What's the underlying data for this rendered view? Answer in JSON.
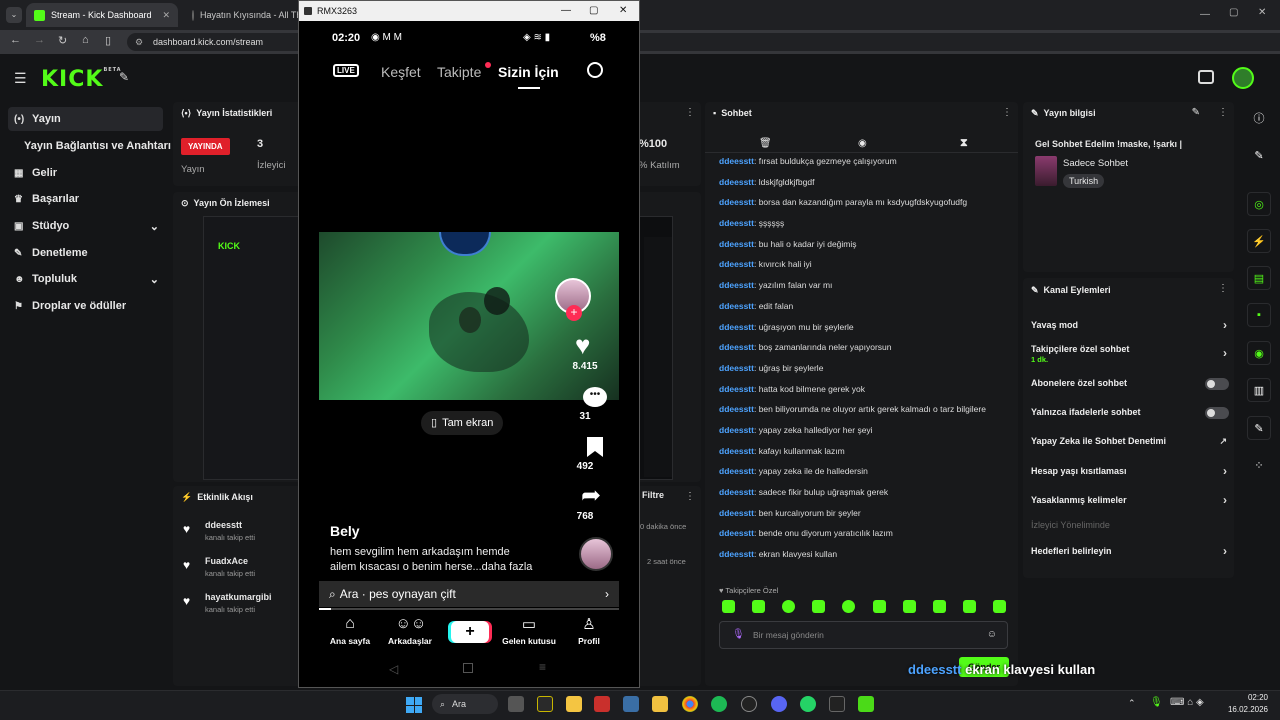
{
  "browser": {
    "tabs": [
      {
        "title": "Stream - Kick Dashboard"
      },
      {
        "title": "Hayatın Kıyısında - All The"
      }
    ],
    "url": "dashboard.kick.com/stream"
  },
  "kick": {
    "logo": "KICK",
    "logo_badge": "BETA"
  },
  "sidebar": {
    "items": [
      {
        "label": "Yayın",
        "icon": "broadcast-icon"
      },
      {
        "label": "Yayın Bağlantısı ve Anahtarı",
        "icon": ""
      },
      {
        "label": "Gelir",
        "icon": "revenue-icon"
      },
      {
        "label": "Başarılar",
        "icon": "trophy-icon"
      },
      {
        "label": "Stüdyo",
        "icon": "studio-icon"
      },
      {
        "label": "Denetleme",
        "icon": "wrench-icon"
      },
      {
        "label": "Topluluk",
        "icon": "community-icon"
      },
      {
        "label": "Droplar ve ödüller",
        "icon": "gift-icon"
      }
    ]
  },
  "stats": {
    "title": "Yayın İstatistikleri",
    "badge": "YAYINDA",
    "badge_sub": "Yayın",
    "viewers": "3",
    "viewers_label": "İzleyici",
    "percent": "%100",
    "percent_label": "% Katılım"
  },
  "preview": {
    "title": "Yayın Ön İzlemesi"
  },
  "activity": {
    "title": "Etkinlik Akışı",
    "filter": "Filtre",
    "items": [
      {
        "name": "ddeesstt",
        "action": "kanalı takip etti",
        "time": "0 dakika önce"
      },
      {
        "name": "FuadxAce",
        "action": "kanalı takip etti",
        "time": "2 saat önce"
      },
      {
        "name": "hayatkumargibi",
        "action": "kanalı takip etti",
        "time": ""
      }
    ]
  },
  "chat": {
    "title": "Sohbet",
    "user": "ddeesstt",
    "messages": [
      "fırsat buldukça gezmeye çalışıyorum",
      "ldskjfgldkjfbgdf",
      "borsa dan kazandığım parayla mı ksdyugfdskyugofudfg",
      "şşşşşş",
      "bu hali o kadar iyi değimiş",
      "kıvırcık hali iyi",
      "yazılım falan var mı",
      "edit falan",
      "uğraşıyon mu bir şeylerle",
      "boş zamanlarında neler yapıyorsun",
      "uğraş bir şeylerle",
      "hatta kod bilmene gerek yok",
      "ben biliyorumda ne oluyor artık gerek kalmadı o tarz bilgilere",
      "yapay zeka hallediyor her şeyi",
      "kafayı kullanmak lazım",
      "yapay zeka ile de halledersin",
      "sadece fikir bulup uğraşmak gerek",
      "ben kurcalıyorum bir şeyler",
      "bende onu diyorum yaratıcılık lazım",
      "ekran klavyesi kullan"
    ],
    "followers_only": "Takipçilere Özel",
    "input_placeholder": "Bir mesaj gönderin",
    "send": "Gönder",
    "overlay_user": "ddeesstt",
    "overlay_text": "ekran klavyesi kullan"
  },
  "streaminfo": {
    "title": "Yayın bilgisi",
    "stream_title": "Gel Sohbet Edelim !maske, !şarkı |",
    "category": "Sadece Sohbet",
    "tag": "Turkish"
  },
  "actions": {
    "title": "Kanal Eylemleri",
    "items": [
      {
        "label": "Yavaş mod",
        "sub": "",
        "control": "chevron"
      },
      {
        "label": "Takipçilere özel sohbet",
        "sub": "1 dk.",
        "control": "chevron"
      },
      {
        "label": "Abonelere özel sohbet",
        "sub": "",
        "control": "toggle"
      },
      {
        "label": "Yalnızca ifadelerle sohbet",
        "sub": "",
        "control": "toggle"
      },
      {
        "label": "Yapay Zeka ile Sohbet Denetimi",
        "sub": "",
        "control": "external"
      },
      {
        "label": "Hesap yaşı kısıtlaması",
        "sub": "",
        "control": "chevron"
      },
      {
        "label": "Yasaklanmış kelimeler",
        "sub": "",
        "control": "chevron"
      },
      {
        "label": "İzleyici Yöneliminde",
        "sub": "",
        "control": "none"
      },
      {
        "label": "Hedefleri belirleyin",
        "sub": "",
        "control": "chevron"
      }
    ]
  },
  "phone": {
    "window_title": "RMX3263",
    "time": "02:20",
    "battery": "%8",
    "tabs": {
      "live": "LIVE",
      "explore": "Keşfet",
      "following": "Takipte",
      "foryou": "Sizin İçin"
    },
    "likes": "8.415",
    "comments": "31",
    "saves": "492",
    "shares": "768",
    "fullscreen": "Tam ekran",
    "author": "Bely",
    "caption_1": "hem sevgilim hem arkadaşım hemde",
    "caption_2": "ailem kısacası o benim herse...daha fazla",
    "search": "Ara · pes oynayan çift",
    "nav": {
      "home": "Ana sayfa",
      "friends": "Arkadaşlar",
      "inbox": "Gelen kutusu",
      "profile": "Profil"
    }
  },
  "taskbar": {
    "search": "Ara",
    "time": "02:20",
    "date": "16.02.2026"
  },
  "colors": {
    "accent": "#53fc18",
    "live_red": "#e0202a",
    "chat_user": "#4da3ff"
  }
}
